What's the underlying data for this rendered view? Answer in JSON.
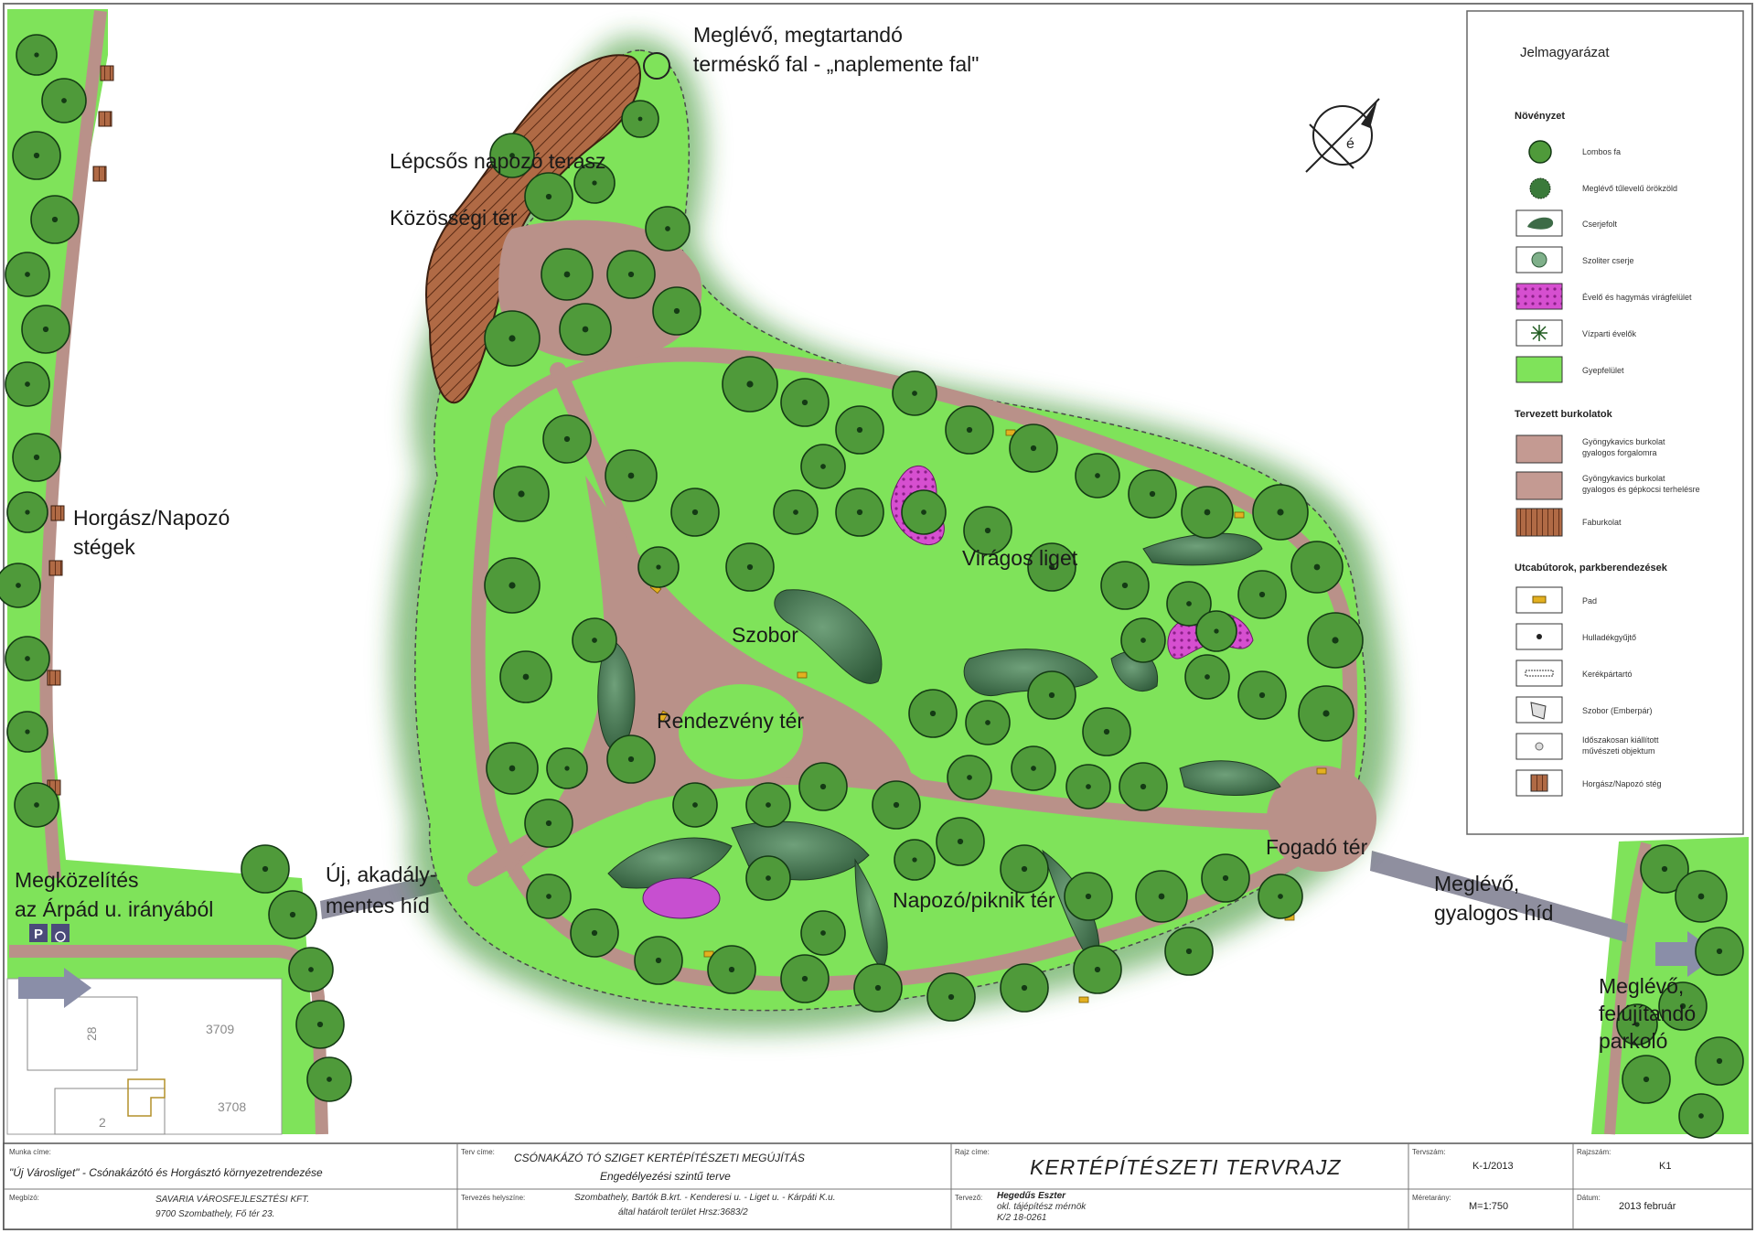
{
  "labels": {
    "wall": [
      "Meglévő, megtartandó",
      "terméskő fal - „naplemente fal\""
    ],
    "terrace": "Lépcsős napozó terasz",
    "community": "Közösségi tér",
    "docks": [
      "Horgász/Napozó",
      "stégek"
    ],
    "approach": [
      "Megközelítés",
      "az Árpád u. irányából"
    ],
    "new_bridge": [
      "Új, akadály-",
      "mentes híd"
    ],
    "flower_grove": "Virágos liget",
    "statue": "Szobor",
    "event_square": "Rendezvény tér",
    "reception": "Fogadó tér",
    "picnic": "Napozó/piknik tér",
    "existing_bridge": [
      "Meglévő,",
      "gyalogos híd"
    ],
    "parking": [
      "Meglévő,",
      "felújítandó",
      "parkoló"
    ],
    "parcel_numbers": [
      "3709",
      "3708",
      "28",
      "2"
    ]
  },
  "legend": {
    "title": "Jelmagyarázat",
    "sections": [
      {
        "heading": "Növényzet",
        "items": [
          {
            "icon": "deciduous-tree-icon",
            "label": "Lombos fa"
          },
          {
            "icon": "evergreen-tree-icon",
            "label": "Meglévő tűlevelű örökzöld"
          },
          {
            "icon": "shrub-group-icon",
            "label": "Cserjefolt"
          },
          {
            "icon": "solitary-shrub-icon",
            "label": "Szoliter cserje"
          },
          {
            "icon": "flowerbed-icon",
            "label": "Évelő és hagymás virágfelület"
          },
          {
            "icon": "waterside-perennial-icon",
            "label": "Vízparti évelők"
          },
          {
            "icon": "lawn-icon",
            "label": "Gyepfelület"
          }
        ]
      },
      {
        "heading": "Tervezett burkolatok",
        "items": [
          {
            "icon": "gravel-pedestrian-icon",
            "label": [
              "Gyöngykavics burkolat",
              "gyalogos forgalomra"
            ]
          },
          {
            "icon": "gravel-mixed-icon",
            "label": [
              "Gyöngykavics burkolat",
              "gyalogos és gépkocsi terhelésre"
            ]
          },
          {
            "icon": "wood-deck-icon",
            "label": "Faburkolat"
          }
        ]
      },
      {
        "heading": "Utcabútorok, parkberendezések",
        "items": [
          {
            "icon": "bench-icon",
            "label": "Pad"
          },
          {
            "icon": "bin-icon",
            "label": "Hulladékgyűjtő"
          },
          {
            "icon": "bike-rack-icon",
            "label": "Kerékpártartó"
          },
          {
            "icon": "statue-icon",
            "label": "Szobor (Emberpár)"
          },
          {
            "icon": "art-object-icon",
            "label": [
              "Időszakosan kiállított",
              "művészeti objektum"
            ]
          },
          {
            "icon": "dock-icon",
            "label": "Horgász/Napozó stég"
          }
        ]
      }
    ]
  },
  "title_block": {
    "project_caption": "Munka címe:",
    "project": "\"Új Városliget\" - Csónakázótó és Horgásztó környezetrendezése",
    "client_caption": "Megbízó:",
    "client": [
      "SAVARIA VÁROSFEJLESZTÉSI KFT.",
      "9700 Szombathely, Fő tér 23."
    ],
    "plan_caption": "Terv címe:",
    "plan_title": "CSÓNAKÁZÓ TÓ SZIGET KERTÉPÍTÉSZETI MEGÚJÍTÁS",
    "plan_subtitle": "Engedélyezési  szintű terve",
    "location_caption": "Tervezés helyszíne:",
    "location": [
      "Szombathely, Bartók B.krt. - Kenderesi u. - Liget u. - Kárpáti K.u.",
      "által határolt terület Hrsz:3683/2"
    ],
    "drawing_caption": "Rajz címe:",
    "drawing_title": "KERTÉPÍTÉSZETI TERVRAJZ",
    "designer_caption": "Tervező:",
    "designer": [
      "Hegedűs Eszter",
      "okl. tájépítész mérnök",
      "K/2 18-0261"
    ],
    "plan_no_caption": "Tervszám:",
    "plan_no": "K-1/2013",
    "sheet_caption": "Rajzszám:",
    "sheet": "K1",
    "scale_caption": "Méretarány:",
    "scale": "M=1:750",
    "date_caption": "Dátum:",
    "date": "2013 február"
  },
  "colors": {
    "lawn": "#7fe35a",
    "path": "#b99189",
    "deck": "#b06a45",
    "flowers": "#d64fd0",
    "tree": "#4f9a3a",
    "shrub": "#3d6b47",
    "bridge": "#8f8f9f"
  }
}
